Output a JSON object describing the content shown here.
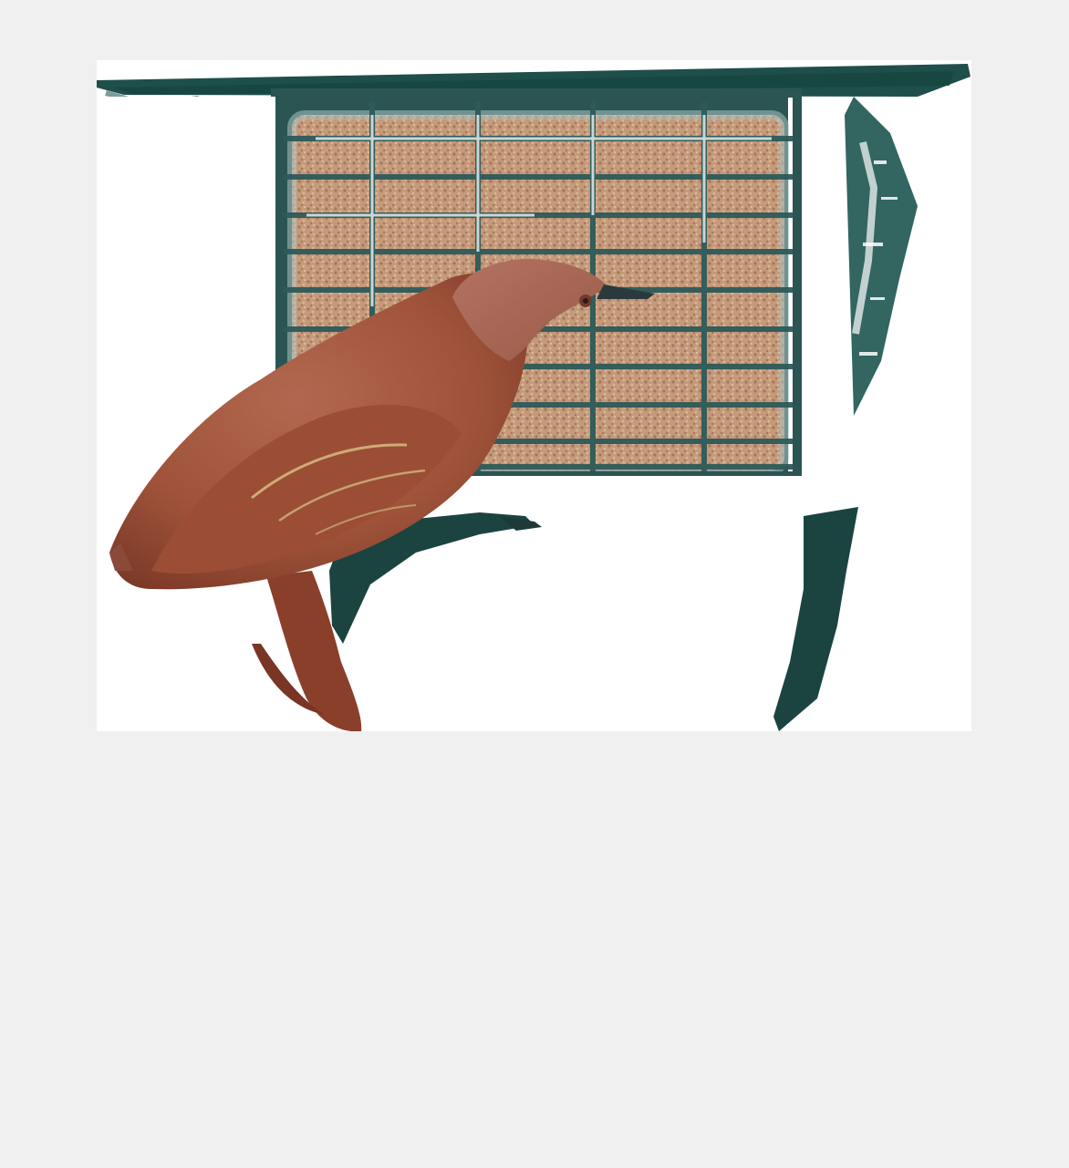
{
  "scene": {
    "subject": "bird-on-suet-feeder",
    "colors": {
      "background": "#f0f0f0",
      "photo_base": "#ffffff",
      "feeder_green": "#1f4f4a",
      "feeder_dark": "#0f3a36",
      "cage_wire": "#2f5a5a",
      "suet": "#c49a7a",
      "bird_body": "#a4583f",
      "bird_shadow": "#6b3526",
      "bird_head": "#b06b57"
    }
  }
}
